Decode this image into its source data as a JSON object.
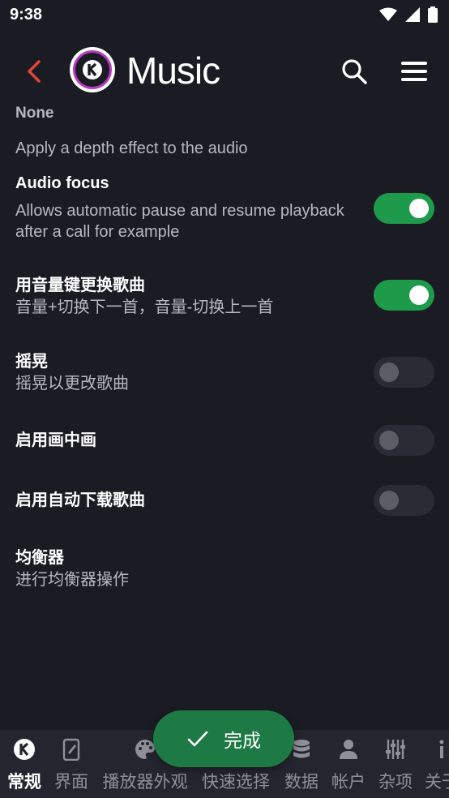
{
  "status_bar": {
    "time": "9:38"
  },
  "app_bar": {
    "title": "Music",
    "logo_letter": "K"
  },
  "clipped_item_text": "None",
  "settings": [
    {
      "title": "",
      "subtitle": "Apply a depth effect to the audio"
    },
    {
      "title": "Audio focus",
      "subtitle": "Allows automatic pause and resume playback after a call for example",
      "toggle": "on"
    },
    {
      "title": "用音量键更换歌曲",
      "subtitle": "音量+切换下一首，音量-切换上一首",
      "toggle": "on"
    },
    {
      "title": "摇晃",
      "subtitle": "摇晃以更改歌曲",
      "toggle": "off"
    },
    {
      "title": "启用画中画",
      "subtitle": "",
      "toggle": "off"
    },
    {
      "title": "启用自动下载歌曲",
      "subtitle": "",
      "toggle": "off"
    },
    {
      "title": "均衡器",
      "subtitle": "进行均衡器操作"
    }
  ],
  "fab": {
    "label": "完成",
    "icon": "check-icon"
  },
  "bottom_nav": [
    {
      "label": "常规",
      "icon": "app-logo-icon",
      "active": true
    },
    {
      "label": "界面",
      "icon": "edit-phone-icon"
    },
    {
      "label": "播放器外观",
      "icon": "palette-icon"
    },
    {
      "label": "快速选择",
      "icon": "filter-icon"
    },
    {
      "label": "数据",
      "icon": "database-icon"
    },
    {
      "label": "帐户",
      "icon": "person-icon"
    },
    {
      "label": "杂项",
      "icon": "tune-icon"
    },
    {
      "label": "关于",
      "icon": "info-icon"
    }
  ],
  "colors": {
    "background": "#1b1b23",
    "accent_green": "#1e9a4b",
    "back_arrow": "#e0443c",
    "logo_ring": "#b63ac2"
  }
}
